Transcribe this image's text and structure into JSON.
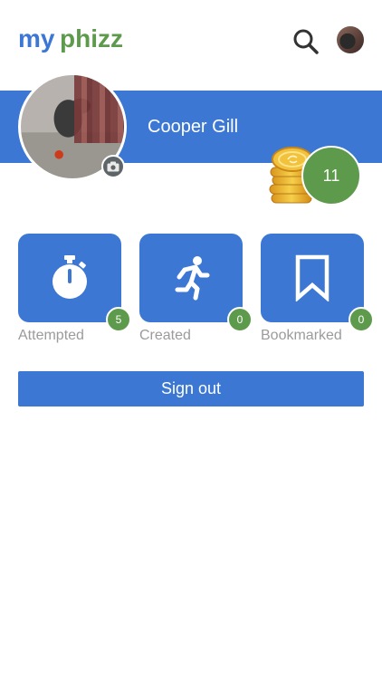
{
  "header": {
    "logo": {
      "part1": "my",
      "part2": "phizz",
      "color1": "#3b77d3",
      "color2": "#5d9a4c"
    },
    "search_icon": "search-icon",
    "avatar": "user-avatar"
  },
  "profile": {
    "name": "Cooper Gill",
    "points": "11",
    "camera_icon": "camera-icon",
    "coins_icon": "coins-icon"
  },
  "tiles": [
    {
      "label": "Attempted",
      "count": "5",
      "icon": "stopwatch-icon"
    },
    {
      "label": "Created",
      "count": "0",
      "icon": "running-person-icon"
    },
    {
      "label": "Bookmarked",
      "count": "0",
      "icon": "bookmark-icon"
    }
  ],
  "actions": {
    "sign_out": "Sign out"
  },
  "colors": {
    "primary": "#3b77d3",
    "badge": "#5d9a4c",
    "label": "#9b9b9b"
  }
}
